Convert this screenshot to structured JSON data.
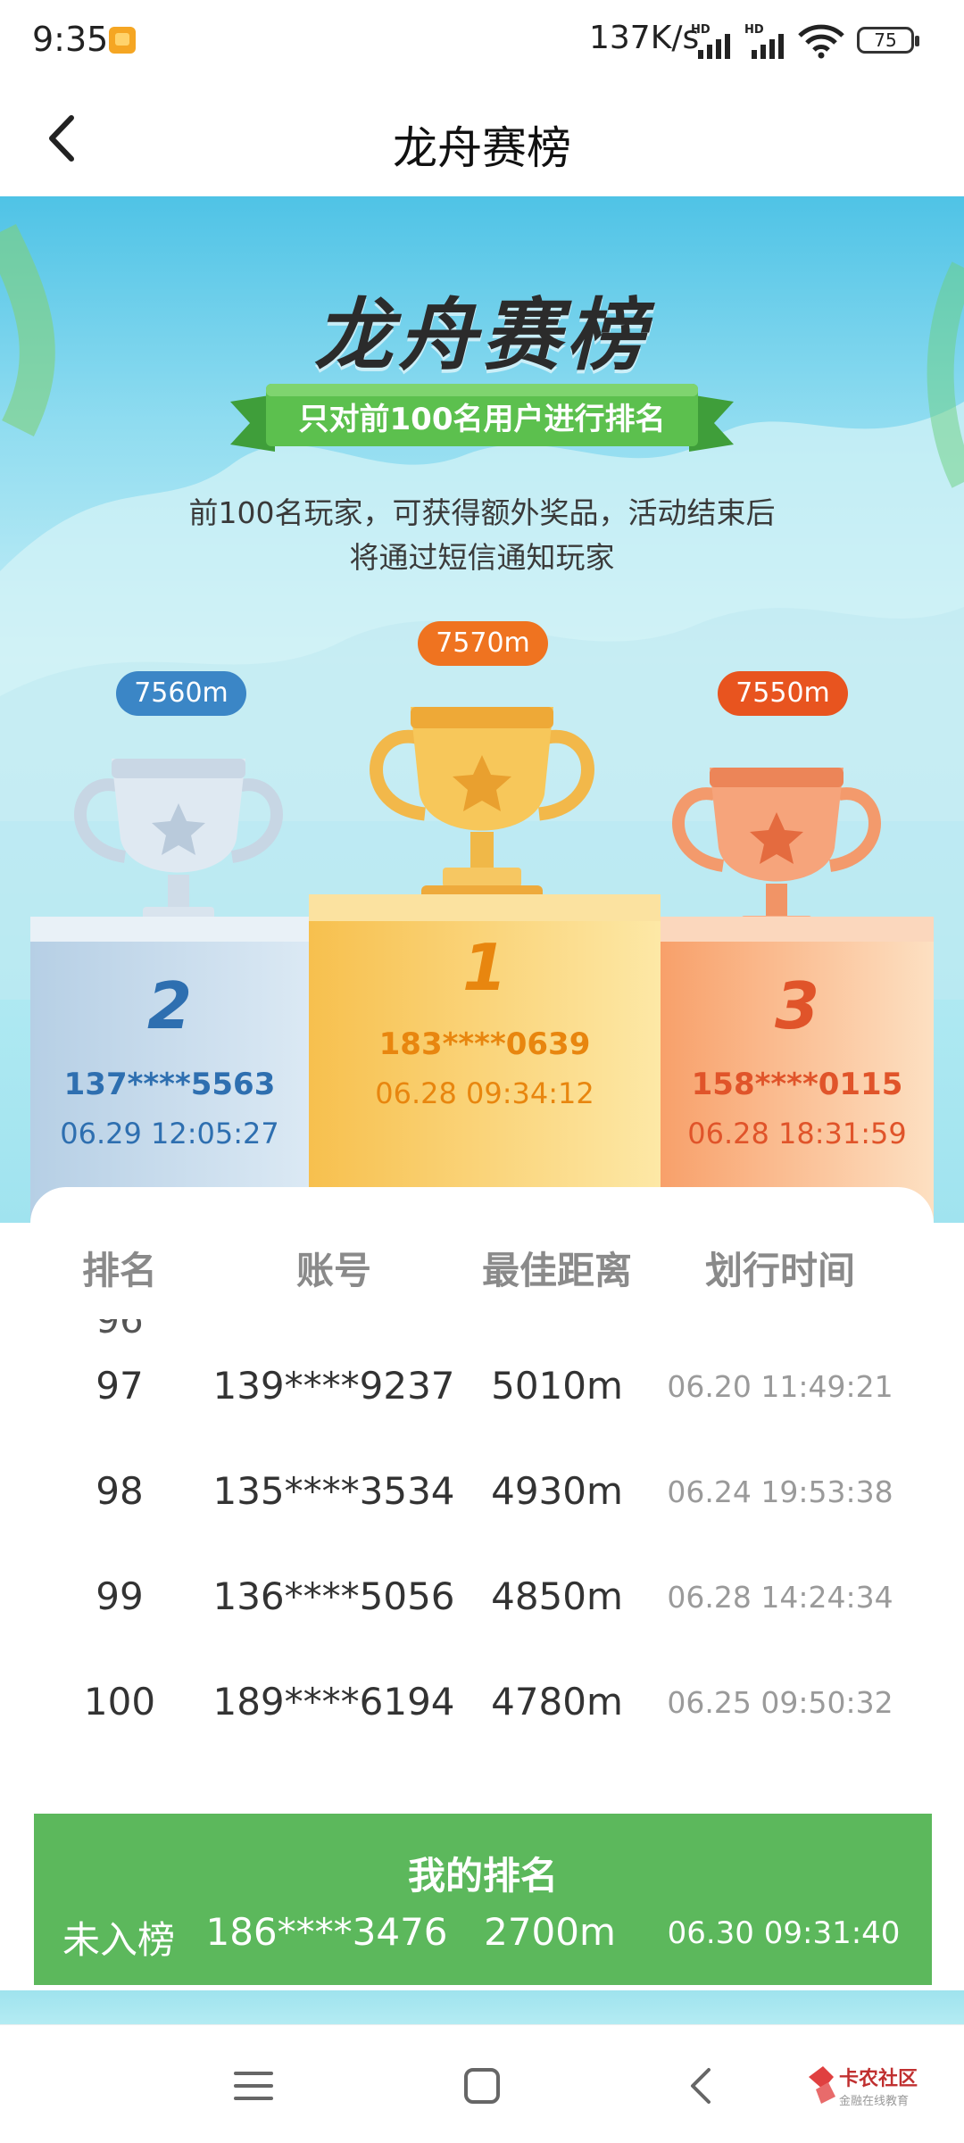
{
  "status_bar": {
    "time": "9:35",
    "network_speed": "137K/s",
    "signal_badge": "HD",
    "battery": "75"
  },
  "nav": {
    "title": "龙舟赛榜"
  },
  "hero": {
    "title": "龙舟赛榜",
    "ribbon": "只对前100名用户进行排名",
    "desc_line1": "前100名玩家，可获得额外奖品，活动结束后",
    "desc_line2": "将通过短信通知玩家"
  },
  "podium": {
    "first": {
      "rank": "1",
      "distance": "7570m",
      "account": "183****0639",
      "time": "06.28 09:34:12",
      "color": "#e8860f"
    },
    "second": {
      "rank": "2",
      "distance": "7560m",
      "account": "137****5563",
      "time": "06.29 12:05:27",
      "color": "#2e6fb0"
    },
    "third": {
      "rank": "3",
      "distance": "7550m",
      "account": "158****0115",
      "time": "06.28 18:31:59",
      "color": "#e0542a"
    }
  },
  "table": {
    "headers": [
      "排名",
      "账号",
      "最佳距离",
      "划行时间"
    ],
    "rows": [
      {
        "rank": "97",
        "account": "139****9237",
        "distance": "5010m",
        "time": "06.20 11:49:21"
      },
      {
        "rank": "98",
        "account": "135****3534",
        "distance": "4930m",
        "time": "06.24 19:53:38"
      },
      {
        "rank": "99",
        "account": "136****5056",
        "distance": "4850m",
        "time": "06.28 14:24:34"
      },
      {
        "rank": "100",
        "account": "189****6194",
        "distance": "4780m",
        "time": "06.25 09:50:32"
      }
    ]
  },
  "my_rank": {
    "title": "我的排名",
    "rank": "未入榜",
    "account": "186****3476",
    "distance": "2700m",
    "time": "06.30 09:31:40"
  },
  "watermark": {
    "name": "卡农社区",
    "tagline": "金融在线教育"
  },
  "colors": {
    "green": "#5cb85c",
    "gold": "#f5b731",
    "silver": "#c9dbe9",
    "bronze": "#f49b6a",
    "blue_pill": "#3b86c6",
    "orange_pill": "#ef7320",
    "red_pill": "#e8541f"
  }
}
